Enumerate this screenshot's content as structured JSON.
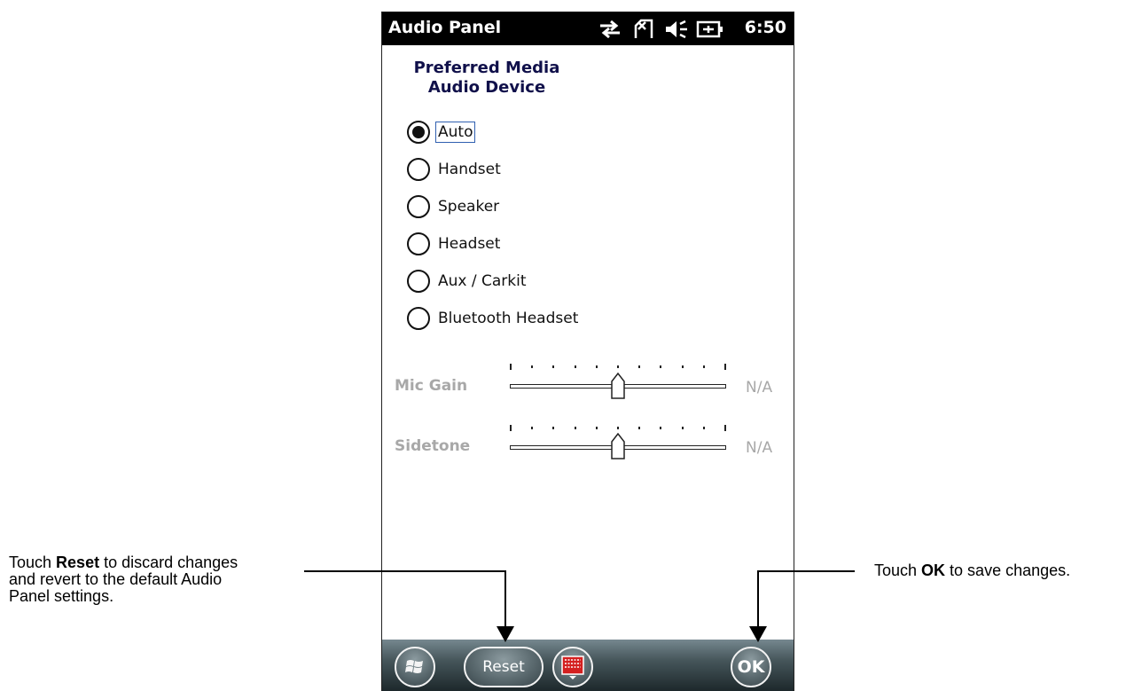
{
  "titlebar": {
    "title": "Audio Panel",
    "time": "6:50",
    "icons": [
      "sync-arrows-icon",
      "no-sim-icon",
      "speaker-volume-icon",
      "battery-charging-icon"
    ]
  },
  "heading": {
    "line1": "Preferred Media",
    "line2": "Audio Device"
  },
  "options": [
    {
      "label": "Auto",
      "selected": true
    },
    {
      "label": "Handset",
      "selected": false
    },
    {
      "label": "Speaker",
      "selected": false
    },
    {
      "label": "Headset",
      "selected": false
    },
    {
      "label": "Aux / Carkit",
      "selected": false
    },
    {
      "label": "Bluetooth Headset",
      "selected": false
    }
  ],
  "sliders": [
    {
      "label": "Mic Gain",
      "value": "N/A",
      "level_fraction": 0.5,
      "enabled": false
    },
    {
      "label": "Sidetone",
      "value": "N/A",
      "level_fraction": 0.5,
      "enabled": false
    }
  ],
  "menubar": {
    "reset_label": "Reset",
    "ok_label": "OK",
    "icons": [
      "windows-start-icon",
      "keyboard-icon"
    ]
  },
  "callouts": {
    "reset": {
      "prefix": "Touch ",
      "bold": "Reset",
      "suffix": " to discard changes",
      "line2": "and revert to the default Audio",
      "line3": "Panel settings."
    },
    "ok": {
      "prefix": "Touch ",
      "bold": "OK",
      "suffix": " to save changes."
    }
  },
  "colors": {
    "heading": "#10104a",
    "disabled_text": "#a8a8a8",
    "focus_outline": "#3060b0",
    "keyboard_icon": "#d42020"
  }
}
